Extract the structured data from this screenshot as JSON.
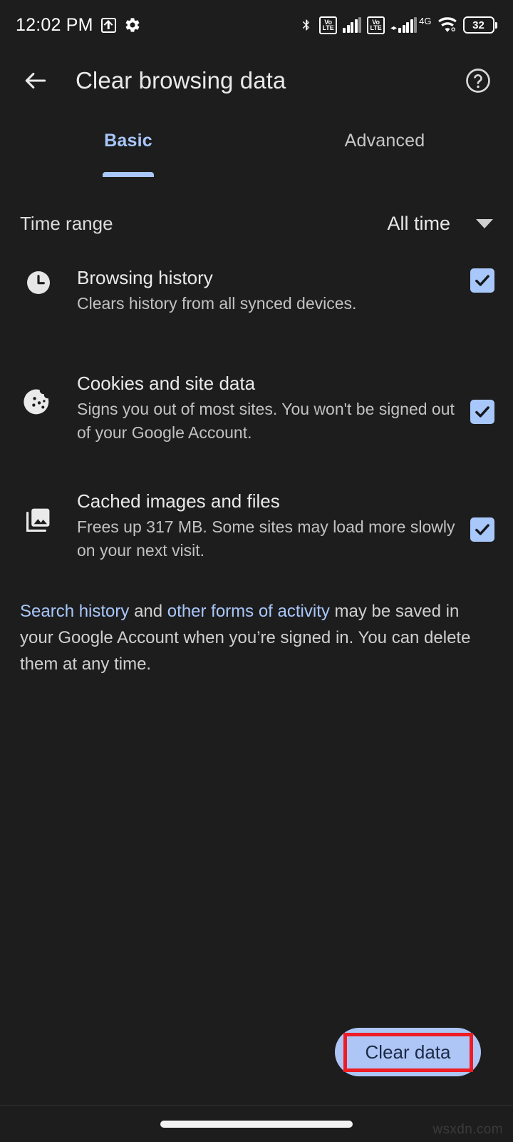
{
  "status_bar": {
    "time": "12:02 PM",
    "left_icons": [
      "upload-icon",
      "gear-icon"
    ],
    "right_icons": [
      "bluetooth-icon",
      "volte-icon",
      "signal-icon",
      "volte-icon",
      "4g-signal-icon",
      "wifi-icon",
      "battery-icon"
    ],
    "volte_top": "Vo",
    "volte_bottom": "LTE",
    "network_label": "4G",
    "data_arrows": "◂▸",
    "battery_level": "32"
  },
  "app_bar": {
    "back_icon": "back-arrow-icon",
    "title": "Clear browsing data",
    "help_icon": "help-circle-icon"
  },
  "tabs": [
    {
      "label": "Basic",
      "active": true
    },
    {
      "label": "Advanced",
      "active": false
    }
  ],
  "time_range": {
    "label": "Time range",
    "value": "All time",
    "caret_icon": "chevron-down-icon"
  },
  "options": [
    {
      "icon": "clock-icon",
      "title": "Browsing history",
      "description": "Clears history from all synced devices.",
      "checked": true
    },
    {
      "icon": "cookie-icon",
      "title": "Cookies and site data",
      "description": "Signs you out of most sites. You won't be signed out of your Google Account.",
      "checked": true
    },
    {
      "icon": "photo-library-icon",
      "title": "Cached images and files",
      "description": "Frees up 317 MB. Some sites may load more slowly on your next visit.",
      "checked": true
    }
  ],
  "footnote": {
    "link1": "Search history",
    "mid": " and ",
    "link2": "other forms of activity",
    "tail": " may be saved in your Google Account when you’re signed in. You can delete them at any time."
  },
  "cta": {
    "clear_data_label": "Clear data",
    "highlight_color": "#EE1D25"
  },
  "nav_bar": {
    "home_indicator": "home-pill"
  },
  "watermark": "wsxdn.com",
  "colors": {
    "background": "#1D1D1D",
    "accent": "#A8C7FA",
    "primary_text": "#E9E9E9",
    "secondary_text": "#C2C2C2",
    "button_bg": "#AEC6F6",
    "button_text": "#1B2B45"
  }
}
